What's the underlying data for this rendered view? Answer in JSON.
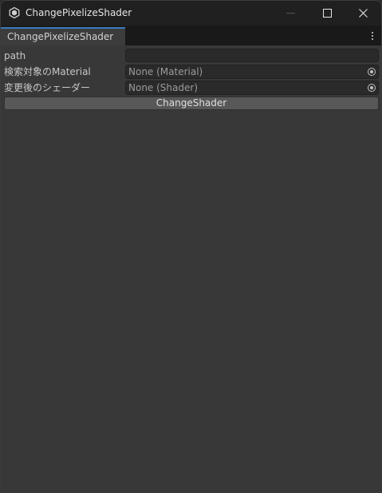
{
  "window": {
    "title": "ChangePixelizeShader",
    "icon": "unity-logo-icon",
    "controls": {
      "minimize": "minimize-icon",
      "maximize": "maximize-icon",
      "close": "close-icon"
    }
  },
  "tabs": [
    {
      "label": "ChangePixelizeShader",
      "active": true
    }
  ],
  "menu_icon": "more-vertical-icon",
  "fields": {
    "path": {
      "label": "path",
      "value": ""
    },
    "material": {
      "label": "検索対象のMaterial",
      "value": "None (Material)",
      "picker_icon": "object-picker-icon"
    },
    "shader": {
      "label": "変更後のシェーダー",
      "value": "None (Shader)",
      "picker_icon": "object-picker-icon"
    }
  },
  "buttons": {
    "change_shader": "ChangeShader"
  },
  "colors": {
    "titlebar": "#202020",
    "panel": "#383838",
    "tab_accent": "#3a79bb",
    "field_bg": "#2a2a2a",
    "button_bg": "#585858"
  }
}
